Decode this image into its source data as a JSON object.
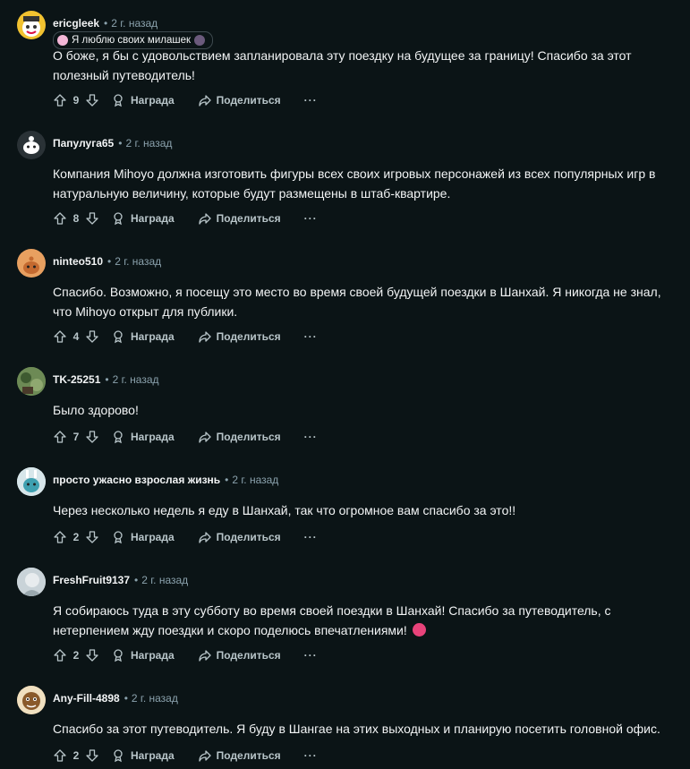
{
  "actions": {
    "award_label": "Награда",
    "share_label": "Поделиться",
    "more_label": "···"
  },
  "comments": [
    {
      "username": "ericgleek",
      "time": "2 г. назад",
      "flair": "Я люблю своих милашек",
      "lines": [
        "О боже, я бы с удовольствием запланировала эту поездку на будущее за границу! Спасибо за этот",
        "полезный путеводитель!"
      ],
      "score": "9",
      "avatar_color": "#f2c230"
    },
    {
      "username": "Папулуга65",
      "time": "2 г. назад",
      "lines": [
        "Компания Mihoyo должна изготовить фигуры всех своих игровых персонажей из всех популярных игр в",
        "натуральную величину, которые будут размещены в штаб-квартире."
      ],
      "score": "8",
      "avatar_color": "#ffffff"
    },
    {
      "username": "ninteo510",
      "time": "2 г. назад",
      "lines": [
        "Спасибо. Возможно, я посещу это место во время своей будущей поездки в Шанхай. Я никогда не знал,",
        "что Mihoyo открыт для публики."
      ],
      "score": "4",
      "avatar_color": "#e8a060"
    },
    {
      "username": "TK-25251",
      "time": "2 г. назад",
      "lines": [
        "Было здорово!"
      ],
      "score": "7",
      "avatar_color": "#5a7a4a"
    },
    {
      "username": "просто ужасно взрослая жизнь",
      "time": "2 г. назад",
      "lines": [
        "Через несколько недель я еду в Шанхай, так что огромное вам спасибо за это!!"
      ],
      "score": "2",
      "avatar_color": "#3fa0b0"
    },
    {
      "username": "FreshFruit9137",
      "time": "2 г. назад",
      "lines": [
        "Я собираюсь туда в эту субботу во время своей поездки в Шанхай! Спасибо за путеводитель, с",
        "нетерпением жду поездки и скоро поделюсь впечатлениями!"
      ],
      "score": "2",
      "avatar_color": "#c9d3d8",
      "emoji": "face-savoring-icon"
    },
    {
      "username": "Any-Fill-4898",
      "time": "2 г. назад",
      "lines": [
        "Спасибо за этот путеводитель. Я буду в Шангае на этих выходных и планирую посетить головной офис."
      ],
      "score": "2",
      "avatar_color": "#8a5a2a"
    }
  ]
}
